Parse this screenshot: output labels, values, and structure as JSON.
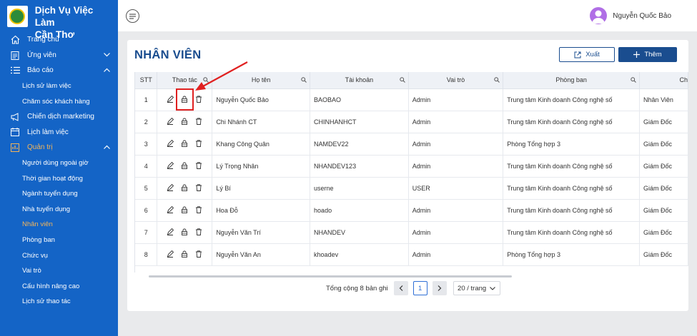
{
  "app": {
    "brand_line1": "Dịch Vụ Việc Làm",
    "brand_line2": "Cần Thơ"
  },
  "sidebar": {
    "items": [
      {
        "label": "Trang chủ",
        "icon": "home-icon"
      },
      {
        "label": "Ứng viên",
        "icon": "clipboard-icon",
        "chevron": "down"
      },
      {
        "label": "Báo cáo",
        "icon": "list-icon",
        "chevron": "up"
      },
      {
        "label": "Lịch sử làm việc",
        "sub": true
      },
      {
        "label": "Chăm sóc khách hàng",
        "sub": true
      },
      {
        "label": "Chiến dịch marketing",
        "icon": "megaphone-icon"
      },
      {
        "label": "Lịch làm việc",
        "icon": "calendar-icon"
      },
      {
        "label": "Quản trị",
        "icon": "admin-icon",
        "chevron": "up",
        "active": true
      },
      {
        "label": "Người dùng ngoài giờ",
        "sub": true
      },
      {
        "label": "Thời gian hoạt động",
        "sub": true
      },
      {
        "label": "Ngành tuyển dụng",
        "sub": true
      },
      {
        "label": "Nhà tuyển dụng",
        "sub": true
      },
      {
        "label": "Nhân viên",
        "sub": true,
        "active": true
      },
      {
        "label": "Phòng ban",
        "sub": true
      },
      {
        "label": "Chức vụ",
        "sub": true
      },
      {
        "label": "Vai trò",
        "sub": true
      },
      {
        "label": "Cấu hình nâng cao",
        "sub": true
      },
      {
        "label": "Lịch sử thao tác",
        "sub": true
      }
    ]
  },
  "header": {
    "user_name": "Nguyễn Quốc Bảo"
  },
  "main": {
    "title": "NHÂN VIÊN",
    "export_label": "Xuất",
    "add_label": "Thêm"
  },
  "table": {
    "columns": [
      "STT",
      "Thao tác",
      "Họ tên",
      "Tài khoản",
      "Vai trò",
      "Phòng ban",
      "Ch"
    ],
    "rows": [
      {
        "stt": "1",
        "name": "Nguyễn Quốc Bảo",
        "account": "BAOBAO",
        "role": "Admin",
        "dept": "Trung tâm Kinh doanh Công nghệ số",
        "pos": "Nhân Viên"
      },
      {
        "stt": "2",
        "name": "Chi Nhánh CT",
        "account": "CHINHANHCT",
        "role": "Admin",
        "dept": "Trung tâm Kinh doanh Công nghệ số",
        "pos": "Giám Đốc"
      },
      {
        "stt": "3",
        "name": "Khang Công Quân",
        "account": "NAMDEV22",
        "role": "Admin",
        "dept": "Phòng Tổng hợp 3",
        "pos": "Giám Đốc"
      },
      {
        "stt": "4",
        "name": "Lý Trọng Nhân",
        "account": "NHANDEV123",
        "role": "Admin",
        "dept": "Trung tâm Kinh doanh Công nghệ số",
        "pos": "Giám Đốc"
      },
      {
        "stt": "5",
        "name": "Lý Bí",
        "account": "userne",
        "role": "USER",
        "dept": "Trung tâm Kinh doanh Công nghệ số",
        "pos": "Giám Đốc"
      },
      {
        "stt": "6",
        "name": "Hoa Đỗ",
        "account": "hoado",
        "role": "Admin",
        "dept": "Trung tâm Kinh doanh Công nghệ số",
        "pos": "Giám Đốc"
      },
      {
        "stt": "7",
        "name": "Nguyễn Văn Trí",
        "account": "NHANDEV",
        "role": "Admin",
        "dept": "Trung tâm Kinh doanh Công nghệ số",
        "pos": "Giám Đốc"
      },
      {
        "stt": "8",
        "name": "Nguyễn Văn An",
        "account": "khoadev",
        "role": "Admin",
        "dept": "Phòng Tổng hợp 3",
        "pos": "Giám Đốc"
      }
    ]
  },
  "pagination": {
    "total": "Tổng cộng 8 bản ghi",
    "current": "1",
    "page_size": "20 / trang"
  },
  "colors": {
    "sidebar": "#1464c6",
    "primary": "#1a4d8f",
    "active_menu": "#f3b55a",
    "annotation": "#e02020"
  }
}
